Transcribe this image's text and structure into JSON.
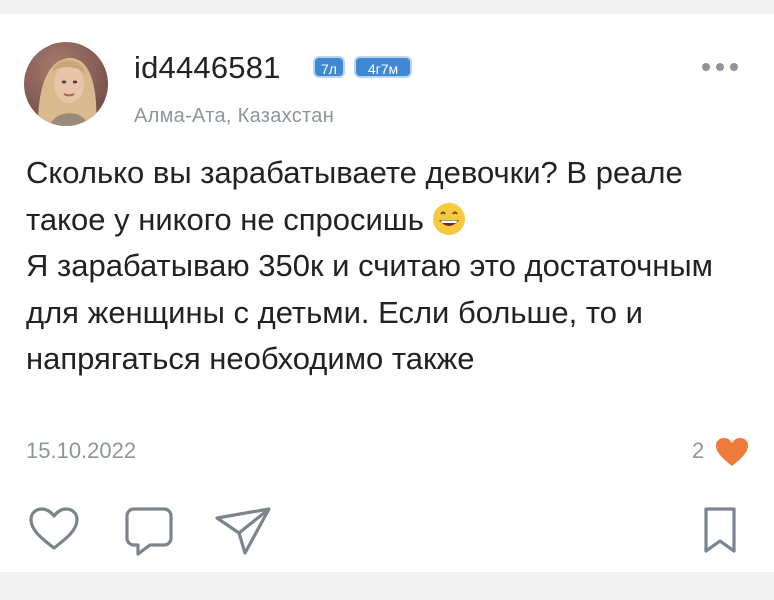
{
  "post": {
    "author": {
      "username": "id4446581",
      "badges": [
        "7л",
        "4г7м"
      ],
      "location": "Алма-Ата, Казахстан",
      "avatar_icon": "profile-photo"
    },
    "text_line1": "Сколько вы зарабатываете девочки? В реале такое у никого не спросишь ",
    "text_line2": "Я зарабатываю 350к и считаю это достаточным для женщины с детьми. Если больше, то и напрягаться необходимо также",
    "emoji_icon": "grinning-face-emoji",
    "date": "15.10.2022",
    "likes": "2",
    "liked": true,
    "accent_color": "#f07a3c"
  },
  "actions": {
    "icons": [
      "heart-outline-icon",
      "comment-icon",
      "share-icon",
      "bookmark-icon",
      "more-icon"
    ]
  }
}
